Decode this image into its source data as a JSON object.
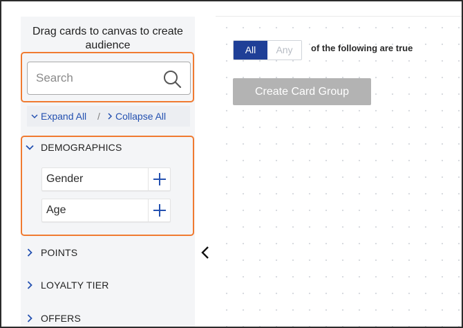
{
  "sidebar": {
    "header": "Drag cards to canvas to create audience",
    "search": {
      "placeholder": "Search",
      "value": ""
    },
    "expand_all": "Expand All",
    "separator": "/",
    "collapse_all": "Collapse All",
    "sections": [
      {
        "label": "DEMOGRAPHICS",
        "expanded": true,
        "cards": [
          {
            "label": "Gender"
          },
          {
            "label": "Age"
          }
        ]
      },
      {
        "label": "POINTS",
        "expanded": false
      },
      {
        "label": "LOYALTY TIER",
        "expanded": false
      },
      {
        "label": "OFFERS",
        "expanded": false
      }
    ]
  },
  "canvas": {
    "match_toggle": {
      "options": [
        "All",
        "Any"
      ],
      "selected": "All"
    },
    "match_suffix": "of the following are true",
    "create_card_group_label": "Create Card Group"
  },
  "colors": {
    "highlight": "#f07a30",
    "primary": "#1f3f97",
    "link": "#2350b0",
    "disabled_button": "#b3b3b3"
  },
  "icons": {
    "search": "search-icon",
    "add": "plus-icon",
    "expand": "chevron-down-icon",
    "collapse": "chevron-right-icon",
    "panel_toggle": "chevron-left-icon"
  }
}
